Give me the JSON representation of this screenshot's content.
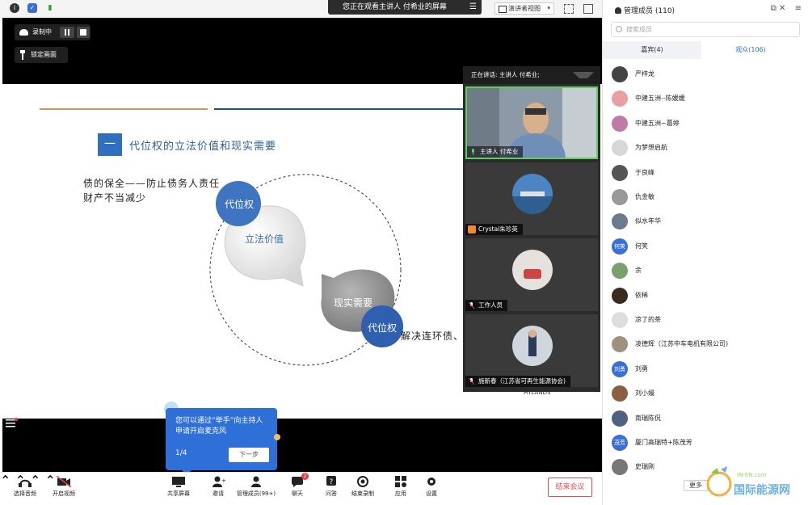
{
  "topbar": {
    "viewing_banner": "您正在观看主讲人 付希业的屏幕",
    "view_mode": "演讲者视图"
  },
  "recording": {
    "label": "录制中",
    "lock_label": "锁定画面"
  },
  "slide": {
    "section_number": "一",
    "heading": "代位权的立法价值和现实需要",
    "left_text": "债的保全——防止债务人责任财产不当减少",
    "right_text": "解决连环债、",
    "bubble_top": "代位权",
    "bubble_center": "立法价值",
    "bubble_bottom_grey": "现实需要",
    "bubble_bottom_blue": "代位权",
    "logo": "HYLANDS"
  },
  "tooltip": {
    "text": "您可以通过“举手”向主持人申请开启麦克风",
    "page": "1/4",
    "next": "下一步"
  },
  "speakers": {
    "header": "正在讲话: 主讲人 付希业;",
    "tiles": [
      {
        "label": "主讲人 付希业"
      },
      {
        "label": "Crystal朱珍英"
      },
      {
        "label": "工作人员"
      },
      {
        "label": "施新春（江苏省可再生能源协会)"
      }
    ]
  },
  "members": {
    "title": "管理成员 (110)",
    "search_placeholder": "搜索成员",
    "tab_guests": "嘉宾(4)",
    "tab_audience": "观众(106)",
    "list": [
      {
        "name": "严梓龙",
        "avatar": "",
        "color": "#444"
      },
      {
        "name": "中建五洲--陈媛媛",
        "avatar": "",
        "color": "#e8a0a0"
      },
      {
        "name": "中建五洲~葛婷",
        "avatar": "",
        "color": "#c07aa8"
      },
      {
        "name": "为梦想启航",
        "avatar": "",
        "color": "#d7d7d7"
      },
      {
        "name": "于良峰",
        "avatar": "",
        "color": "#555"
      },
      {
        "name": "仇金敏",
        "avatar": "",
        "color": "#999"
      },
      {
        "name": "似水年华",
        "avatar": "",
        "color": "#6a7a90"
      },
      {
        "name": "何笑",
        "avatar": "何笑",
        "color": "#3a6fd8"
      },
      {
        "name": "余",
        "avatar": "",
        "color": "#7aa070"
      },
      {
        "name": "依稀",
        "avatar": "",
        "color": "#3a2a20"
      },
      {
        "name": "凉了的茶",
        "avatar": "",
        "color": "#dddddd"
      },
      {
        "name": "凌德辉（江苏中车电机有限公司)",
        "avatar": "",
        "color": "#a09080"
      },
      {
        "name": "刘勇",
        "avatar": "刘勇",
        "color": "#3a6fd8"
      },
      {
        "name": "刘小嫚",
        "avatar": "",
        "color": "#8a6040"
      },
      {
        "name": "南瑞陈侃",
        "avatar": "",
        "color": "#506080"
      },
      {
        "name": "厦门高瑞特+陈茂芳",
        "avatar": "茂芳",
        "color": "#3a6fd8"
      },
      {
        "name": "史瑞刚",
        "avatar": "",
        "color": "#777"
      }
    ],
    "more": "更多"
  },
  "toolbar": {
    "audio": "选择音频",
    "video": "开启视频",
    "share": "共享屏幕",
    "invite": "邀请",
    "manage": "管理成员(99+)",
    "chat": "聊天",
    "chat_badge": "2",
    "qa": "问答",
    "end_record": "结束录制",
    "apps": "应用",
    "settings": "设置",
    "end_meeting": "结束会议"
  },
  "watermark": {
    "site": "IN-EN.com",
    "name": "国际能源网"
  }
}
